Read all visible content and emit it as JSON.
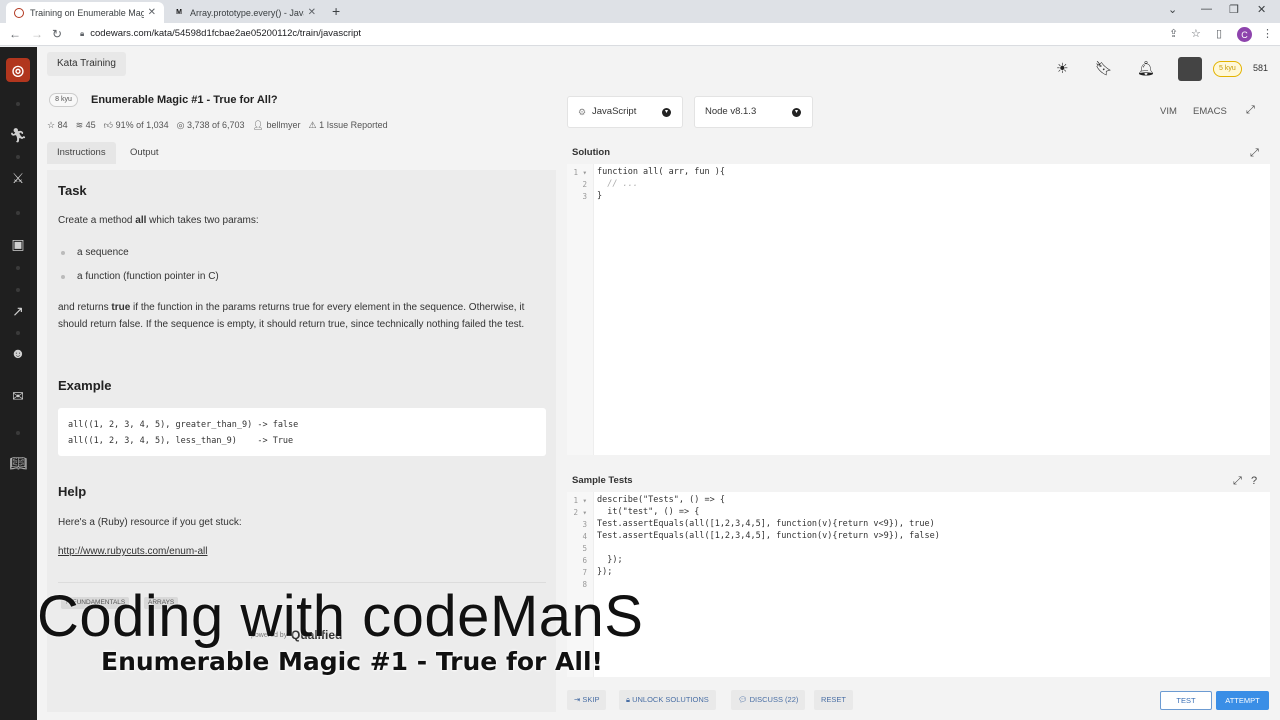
{
  "browser": {
    "tabs": [
      {
        "label": "Training on Enumerable Magic #",
        "close": "✕"
      },
      {
        "label": "Array.prototype.every() - JavaSc",
        "close": "✕"
      }
    ],
    "new_tab": "+",
    "url": "codewars.com/kata/54598d1fcbae2ae05200112c/train/javascript",
    "profile_initial": "C"
  },
  "header": {
    "breadcrumb": "Kata Training",
    "rank_badge": "5 kyu",
    "honor": "581"
  },
  "kata": {
    "kyu": "8 kyu",
    "title": "Enumerable Magic #1 - True for All?",
    "stats": {
      "stars": "84",
      "collections": "45",
      "satisfaction": "91% of 1,034",
      "completed": "3,738 of 6,703",
      "author": "bellmyer",
      "issues": "1 Issue Reported"
    },
    "tabs": [
      "Instructions",
      "Output"
    ]
  },
  "description": {
    "task_heading": "Task",
    "intro_pre": "Create a method ",
    "intro_bold": "all",
    "intro_post": " which takes two params:",
    "params": [
      "a sequence",
      "a function (function pointer in C)"
    ],
    "returns_pre": "and returns ",
    "returns_bold": "true",
    "returns_post": " if the function in the params returns true for every element in the sequence. Otherwise, it should return false. If the sequence is empty, it should return true, since technically nothing failed the test.",
    "example_heading": "Example",
    "example_lines": [
      "all((1, 2, 3, 4, 5), greater_than_9) -> false",
      "all((1, 2, 3, 4, 5), less_than_9)    -> True"
    ],
    "help_heading": "Help",
    "help_text": "Here's a (Ruby) resource if you get stuck:",
    "help_link": "http://www.rubycuts.com/enum-all",
    "tags": [
      "FUNDAMENTALS",
      "ARRAYS"
    ],
    "powered_by": "powered by",
    "qualified": "Qualified"
  },
  "editor": {
    "language": "JavaScript",
    "runtime": "Node v8.1.3",
    "modes": [
      "VIM",
      "EMACS"
    ],
    "solution_title": "Solution",
    "solution_lines": [
      "function all( arr, fun ){",
      "  // ...",
      "}"
    ],
    "tests_title": "Sample Tests",
    "test_lines": [
      "describe(\"Tests\", () => {",
      "  it(\"test\", () => {",
      "Test.assertEquals(all([1,2,3,4,5], function(v){return v<9}), true)",
      "Test.assertEquals(all([1,2,3,4,5], function(v){return v>9}), false)",
      "",
      "  });",
      "});",
      ""
    ]
  },
  "actions": {
    "skip": "SKIP",
    "unlock": "UNLOCK SOLUTIONS",
    "discuss": "DISCUSS (22)",
    "reset": "RESET",
    "test": "TEST",
    "attempt": "ATTEMPT"
  },
  "overlay": {
    "channel": "Coding with codeManS",
    "subtitle": "Enumerable Magic #1 - True for All!"
  }
}
